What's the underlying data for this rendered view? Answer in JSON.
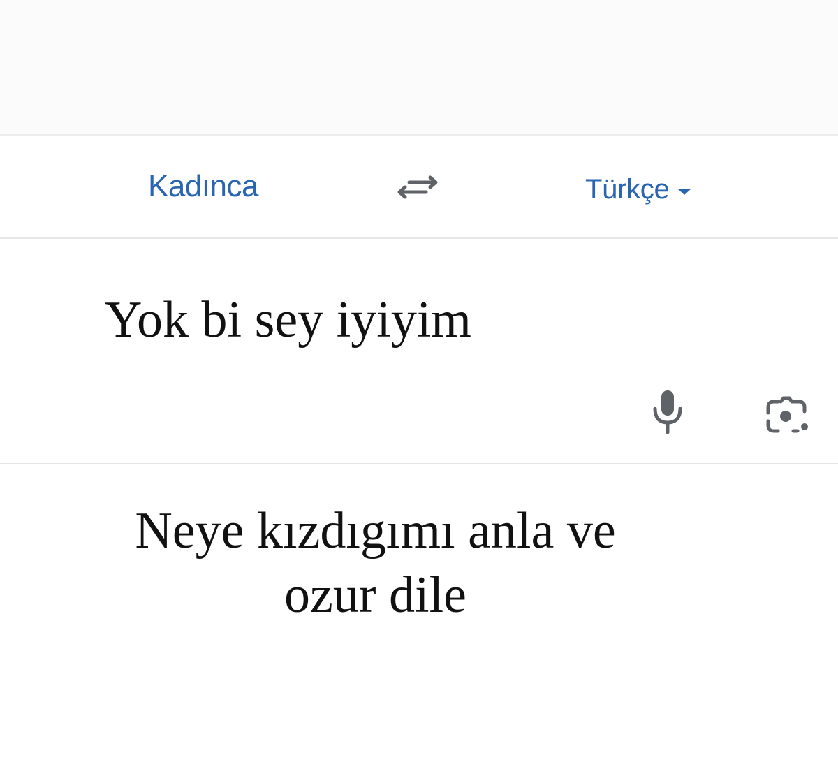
{
  "language_bar": {
    "source_language": "Kadınca",
    "target_language": "Türkçe",
    "swap_icon": "swap-arrows-icon",
    "dropdown_icon": "caret-down-icon"
  },
  "input": {
    "text": "Yok bi sey iyiyim",
    "mic_icon": "microphone-icon",
    "camera_icon": "camera-lens-icon"
  },
  "output": {
    "line1": "Neye kızdıgımı anla ve",
    "line2": "ozur dile"
  },
  "colors": {
    "accent": "#2a66b0",
    "icon_gray": "#5f6368",
    "text": "#111111",
    "divider": "#e6e6e6"
  }
}
